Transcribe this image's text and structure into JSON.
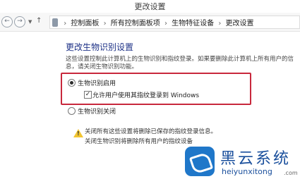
{
  "window": {
    "title": "更改设置"
  },
  "addressbar": {
    "breadcrumbs": [
      "控制面板",
      "所有控制面板项",
      "生物特征设备",
      "更改设置"
    ]
  },
  "main": {
    "heading": "更改生物识别设置",
    "description": "这些设置控制此计算机上的生物识别和指纹登录。如果要删除此计算机上所有用户的信息，请关闭生物识别功能。",
    "option_on": {
      "label": "生物识别启用",
      "selected": true
    },
    "sub_option": {
      "label": "允许用户使用其指纹登录到 Windows",
      "checked": true
    },
    "option_off": {
      "label": "生物识别关闭",
      "selected": false
    },
    "warning_line1": "关闭所有这些设置将删除已保存的指纹登录信息。",
    "warning_line2": "关闭生物识别将删除所有用户的指纹设备"
  },
  "watermark": {
    "name": "黑云系统",
    "url": "heiyunxitong",
    "tld": ".com"
  },
  "colors": {
    "heading": "#1e3287",
    "highlight_box": "#c8283c",
    "warning": "#f2c531",
    "watermark": "#1a4f9c"
  }
}
